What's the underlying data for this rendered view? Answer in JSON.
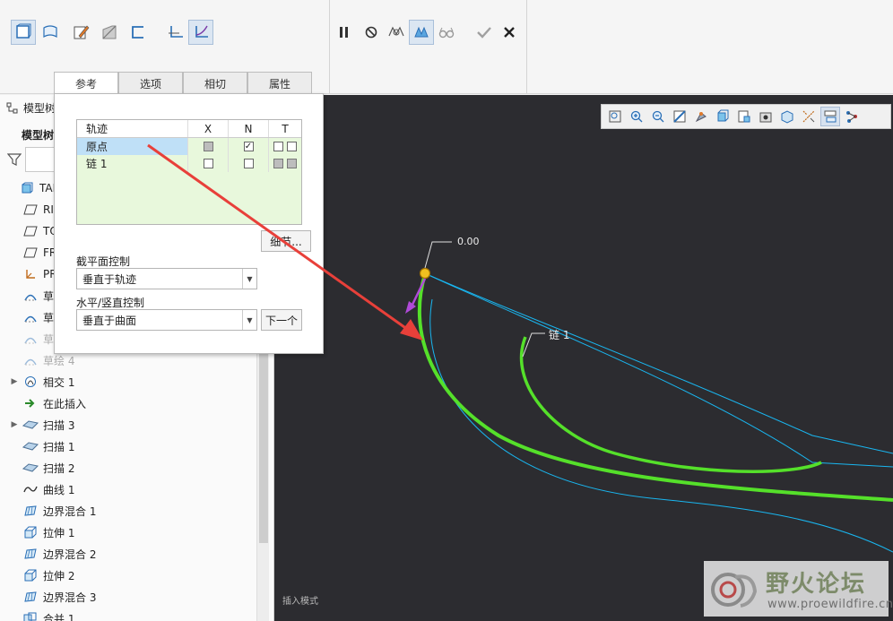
{
  "ribbon": {
    "left_tools": [
      "solid-icon",
      "surface-icon",
      "sketch-edit-icon",
      "remove-material-icon",
      "open-section-icon",
      "constant-section-icon",
      "variable-section-icon"
    ],
    "mid_tools": [
      "pause-icon",
      "no-preview-icon",
      "preview-geometry-icon",
      "preview-feature-icon",
      "verify-glasses-icon",
      "confirm-check-icon",
      "cancel-x-icon"
    ]
  },
  "tabs": [
    {
      "label": "参考",
      "active": true
    },
    {
      "label": "选项",
      "active": false
    },
    {
      "label": "相切",
      "active": false
    },
    {
      "label": "属性",
      "active": false
    }
  ],
  "model_tree": {
    "header": "模型树",
    "sub_header": "模型树",
    "items": [
      {
        "label": "TANG",
        "icon": "part-icon",
        "dim": false,
        "indent": 0
      },
      {
        "label": "RI",
        "icon": "datum-plane-icon",
        "dim": false,
        "indent": 1
      },
      {
        "label": "TO",
        "icon": "datum-plane-icon",
        "dim": false,
        "indent": 1
      },
      {
        "label": "FR",
        "icon": "datum-plane-icon",
        "dim": false,
        "indent": 1
      },
      {
        "label": "PR",
        "icon": "csys-icon",
        "dim": false,
        "indent": 1
      },
      {
        "label": "草",
        "icon": "sketch-icon",
        "dim": false,
        "indent": 1
      },
      {
        "label": "草",
        "icon": "sketch-icon",
        "dim": false,
        "indent": 1
      },
      {
        "label": "草",
        "icon": "sketch-icon",
        "dim": true,
        "indent": 1
      },
      {
        "label": "草绘 4",
        "icon": "sketch-icon",
        "dim": true,
        "indent": 1
      },
      {
        "label": "相交 1",
        "icon": "intersect-icon",
        "dim": false,
        "indent": 1,
        "expandable": true
      },
      {
        "label": "在此插入",
        "icon": "insert-here-icon",
        "dim": false,
        "indent": 1
      },
      {
        "label": "扫描 3",
        "icon": "sweep-icon",
        "dim": false,
        "indent": 1,
        "expandable": true
      },
      {
        "label": "扫描 1",
        "icon": "sweep-icon",
        "dim": false,
        "indent": 1
      },
      {
        "label": "扫描 2",
        "icon": "sweep-icon",
        "dim": false,
        "indent": 1
      },
      {
        "label": "曲线 1",
        "icon": "curve-icon",
        "dim": false,
        "indent": 1
      },
      {
        "label": "边界混合 1",
        "icon": "boundary-blend-icon",
        "dim": false,
        "indent": 1
      },
      {
        "label": "拉伸 1",
        "icon": "extrude-icon",
        "dim": false,
        "indent": 1
      },
      {
        "label": "边界混合 2",
        "icon": "boundary-blend-icon",
        "dim": false,
        "indent": 1
      },
      {
        "label": "拉伸 2",
        "icon": "extrude-icon",
        "dim": false,
        "indent": 1
      },
      {
        "label": "边界混合 3",
        "icon": "boundary-blend-icon",
        "dim": false,
        "indent": 1
      },
      {
        "label": "合并 1",
        "icon": "merge-icon",
        "dim": false,
        "indent": 1
      }
    ]
  },
  "reference_panel": {
    "table_headers": {
      "name": "轨迹",
      "x": "X",
      "n": "N",
      "t": "T"
    },
    "rows": [
      {
        "name": "原点",
        "x": "grey",
        "n": "checked",
        "t": [
          "empty",
          "empty"
        ],
        "selected": true
      },
      {
        "name": "链 1",
        "x": "empty",
        "n": "empty",
        "t": [
          "grey",
          "grey"
        ],
        "selected": false
      }
    ],
    "details_button": "细节...",
    "section_control_label": "截平面控制",
    "section_control_value": "垂直于轨迹",
    "hv_control_label": "水平/竖直控制",
    "hv_control_value": "垂直于曲面",
    "next_button": "下一个"
  },
  "viewport": {
    "dimension_label": "0.00",
    "chain_label": "链 1",
    "status_text": "插入模式",
    "view_tools": [
      "zoom-fit-icon",
      "zoom-in-icon",
      "zoom-out-icon",
      "repaint-icon",
      "orient-icon",
      "display-style-icon",
      "saved-views-icon",
      "view-manager-icon",
      "perspective-icon",
      "datum-display-icon",
      "annotation-icon",
      "spin-center-icon"
    ]
  },
  "watermark": {
    "title": "野火论坛",
    "url": "www.proewildfire.cn"
  },
  "colors": {
    "viewport_bg": "#2c2c30",
    "green_curve": "#55e02a",
    "blue_curve": "#19b6f0",
    "arrow_red": "#e8403a",
    "selection_bg": "#bfe0f7",
    "table_bg": "#e8f8dc"
  }
}
